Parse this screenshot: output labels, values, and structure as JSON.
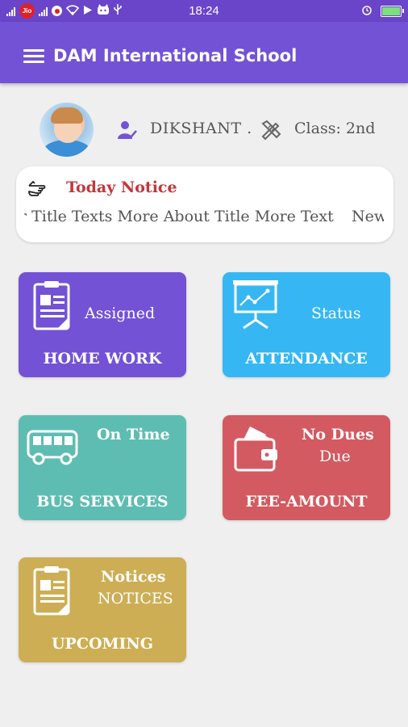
{
  "status_bar": {
    "time": "18:24",
    "carrier_badge": "Jio"
  },
  "app_bar": {
    "title": "DAM International School",
    "menu_icon": "hamburger-menu-icon"
  },
  "profile": {
    "student_name": "DIKSHANT .",
    "class_label": "Class: 2nd"
  },
  "notice": {
    "title": "Today Notice",
    "ticker_text": "r Title Texts More About Title More Text",
    "ticker_text_next": "New"
  },
  "tiles": [
    {
      "id": "homework",
      "label": "HOME WORK",
      "value": "Assigned",
      "color": "#7352d6",
      "icon": "clipboard-icon"
    },
    {
      "id": "attendance",
      "label": "ATTENDANCE",
      "value": "Status",
      "color": "#36b7f3",
      "icon": "presentation-chart-icon"
    },
    {
      "id": "bus",
      "label": "BUS SERVICES",
      "value": "On Time",
      "color": "#5ebdb2",
      "icon": "bus-icon"
    },
    {
      "id": "fee",
      "label": "FEE-AMOUNT",
      "value": "No Dues",
      "value2": "Due",
      "color": "#d35a60",
      "icon": "wallet-icon"
    },
    {
      "id": "upcoming",
      "label": "UPCOMING",
      "value": "Notices",
      "value2": "NOTICES",
      "color": "#cdae55",
      "icon": "clipboard-icon"
    }
  ]
}
